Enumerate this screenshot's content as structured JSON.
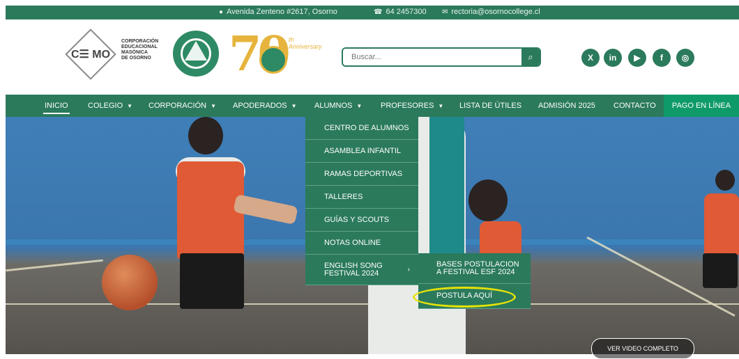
{
  "topbar": {
    "address": "Avenida Zenteno #2617, Osorno",
    "phone": "64 2457300",
    "email": "rectoria@osornocollege.cl"
  },
  "header": {
    "cemo_mark": "C☰ MO",
    "corporation_lines": [
      "CORPORACIÓN",
      "EDUCACIONAL",
      "MASÓNICA",
      "DE OSORNO"
    ],
    "anniversary_number": "70",
    "anniversary_word": "th Anniversary"
  },
  "search": {
    "placeholder": "Buscar..."
  },
  "social": [
    "x-icon",
    "linkedin-icon",
    "youtube-icon",
    "facebook-icon",
    "instagram-icon"
  ],
  "nav": {
    "items": [
      {
        "label": "INICIO"
      },
      {
        "label": "COLEGIO"
      },
      {
        "label": "CORPORACIÓN"
      },
      {
        "label": "APODERADOS"
      },
      {
        "label": "ALUMNOS"
      },
      {
        "label": "PROFESORES"
      },
      {
        "label": "LISTA DE ÚTILES"
      },
      {
        "label": "ADMISIÓN 2025"
      },
      {
        "label": "CONTACTO"
      }
    ],
    "pay_label": "PAGO EN LÍNEA"
  },
  "dropdown": {
    "items": [
      {
        "label": "CENTRO DE ALUMNOS"
      },
      {
        "label": "ASAMBLEA INFANTIL"
      },
      {
        "label": "RAMAS DEPORTIVAS"
      },
      {
        "label": "TALLERES"
      },
      {
        "label": "GUÍAS Y SCOUTS"
      },
      {
        "label": "NOTAS ONLINE"
      },
      {
        "label": "ENGLISH SONG FESTIVAL 2024"
      }
    ]
  },
  "submenu": {
    "items": [
      {
        "label": "BASES POSTULACION A FESTIVAL ESF 2024"
      },
      {
        "label": "POSTULA AQUÍ"
      }
    ]
  },
  "hero": {
    "video_button": "VER VIDEO COMPLETO"
  },
  "colors": {
    "brand": "#2b7a5c",
    "pay": "#0f9a6a",
    "highlight": "#e4e20a",
    "gold": "#e6b43c"
  }
}
